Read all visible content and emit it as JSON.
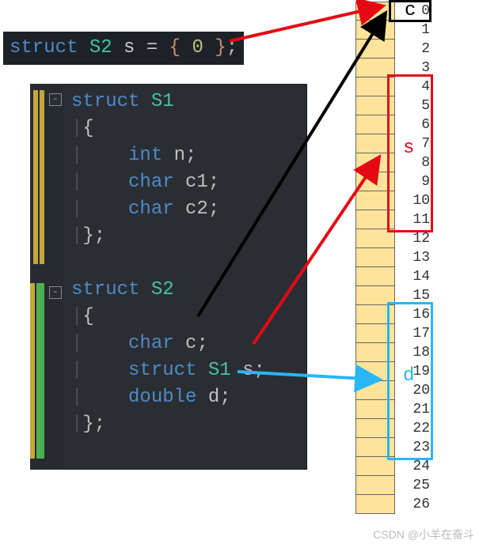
{
  "top_decl": {
    "kw": "struct",
    "typename": "S2",
    "varname": "s",
    "eq": "=",
    "open": "{",
    "zero": "0",
    "close": "}",
    "semi": ";"
  },
  "s1": {
    "kw": "struct",
    "name": "S1",
    "open": "{",
    "close": "};",
    "members": [
      {
        "type": "int",
        "name": "n",
        "semi": ";"
      },
      {
        "type": "char",
        "name": "c1",
        "semi": ";"
      },
      {
        "type": "char",
        "name": "c2",
        "semi": ";"
      }
    ]
  },
  "s2": {
    "kw": "struct",
    "name": "S2",
    "open": "{",
    "close": "};",
    "members": [
      {
        "type": "char",
        "name": "c",
        "semi": ";"
      },
      {
        "type": "struct",
        "typename": "S1",
        "name": "s",
        "semi": ";"
      },
      {
        "type": "double",
        "name": "d",
        "semi": ";"
      }
    ]
  },
  "fold_glyph": "-",
  "memory": {
    "count": 27,
    "labels": {
      "c": "c",
      "s": "s",
      "d": "d"
    },
    "ranges": {
      "c": {
        "from": 0,
        "to": 0
      },
      "s": {
        "from": 4,
        "to": 11
      },
      "d": {
        "from": 16,
        "to": 23
      }
    }
  },
  "colors": {
    "arrow_red": "#e50914",
    "arrow_black": "#000000",
    "arrow_cyan": "#29b6f6"
  },
  "watermark": "CSDN @小羊在奋斗"
}
